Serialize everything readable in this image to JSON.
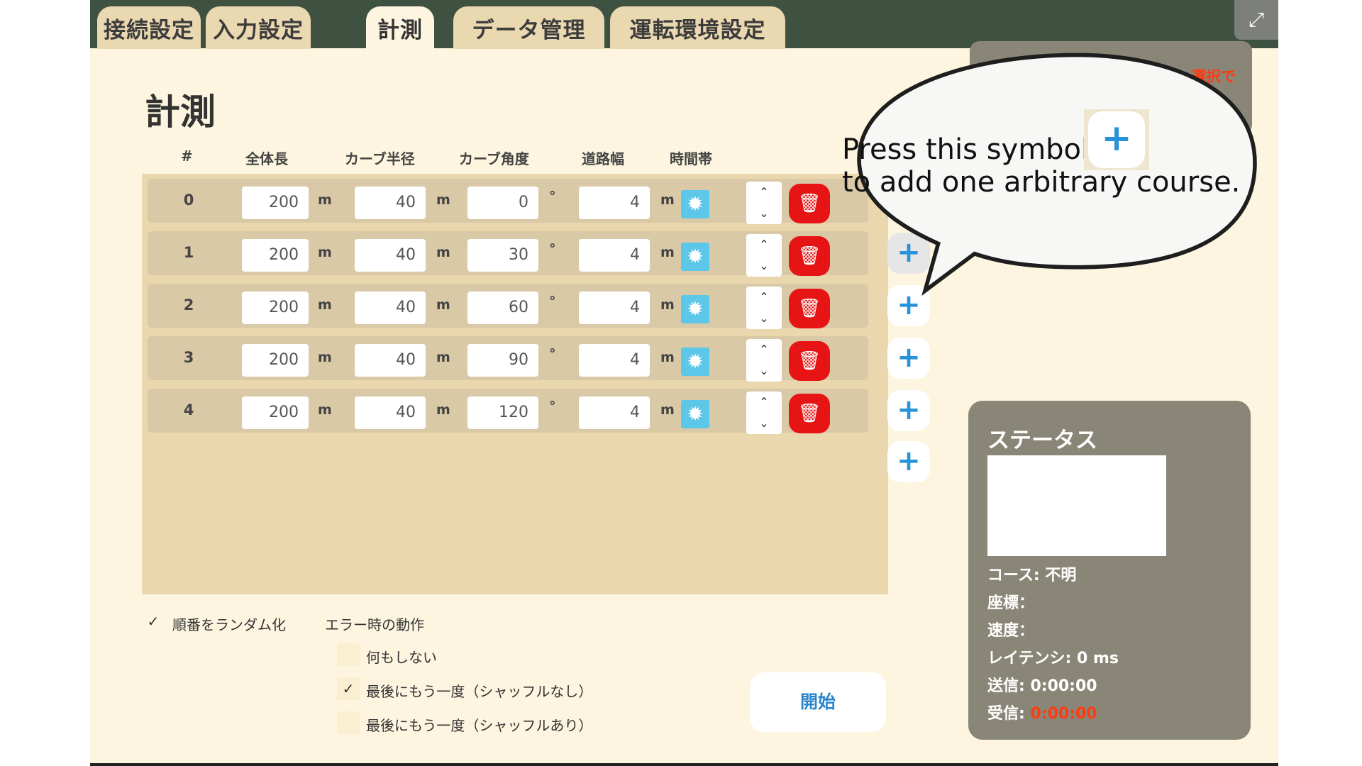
{
  "tabs": [
    "接続設定",
    "入力設定",
    "計測",
    "データ管理",
    "運転環境設定"
  ],
  "page_title": "計測",
  "table": {
    "headers": [
      "#",
      "全体長",
      "カーブ半径",
      "カーブ角度",
      "道路幅",
      "時間帯"
    ],
    "rows": [
      {
        "num": "0",
        "length": "200",
        "radius": "40",
        "angle": "0",
        "width": "4"
      },
      {
        "num": "1",
        "length": "200",
        "radius": "40",
        "angle": "30",
        "width": "4"
      },
      {
        "num": "2",
        "length": "200",
        "radius": "40",
        "angle": "60",
        "width": "4"
      },
      {
        "num": "3",
        "length": "200",
        "radius": "40",
        "angle": "90",
        "width": "4"
      },
      {
        "num": "4",
        "length": "200",
        "radius": "40",
        "angle": "120",
        "width": "4"
      }
    ],
    "unit_m": "m",
    "unit_deg": "°"
  },
  "options": {
    "randomize_label": "順番をランダム化",
    "randomize_checked": true,
    "error_label": "エラー時の動作",
    "error_options": [
      {
        "label": "何もしない",
        "checked": false
      },
      {
        "label": "最後にもう一度（シャッフルなし）",
        "checked": true
      },
      {
        "label": "最後にもう一度（シャッフルあり）",
        "checked": false
      }
    ]
  },
  "start_label": "開始",
  "status": {
    "title": "ステータス",
    "course": "コース: 不明",
    "coords": "座標：",
    "speed": "速度：",
    "latency": "レイテンシ: 0 ms",
    "sent": "送信: 0:00:00",
    "recv_label": "受信: ",
    "recv_value": "0:00:00"
  },
  "warn_text": "選択で",
  "bubble": {
    "line1": "Press this symbol",
    "line2": "to add one arbitrary course."
  },
  "icons": {
    "gear": "sun-gear-icon",
    "delete": "trash-icon",
    "add": "plus-icon",
    "expand": "expand-icon"
  },
  "colors": {
    "topbar": "#3f5242",
    "tab": "#ead8b0",
    "delete": "#e61414",
    "gear": "#5cc7e8",
    "plus": "#2893d9",
    "status_panel": "#8a8677"
  }
}
